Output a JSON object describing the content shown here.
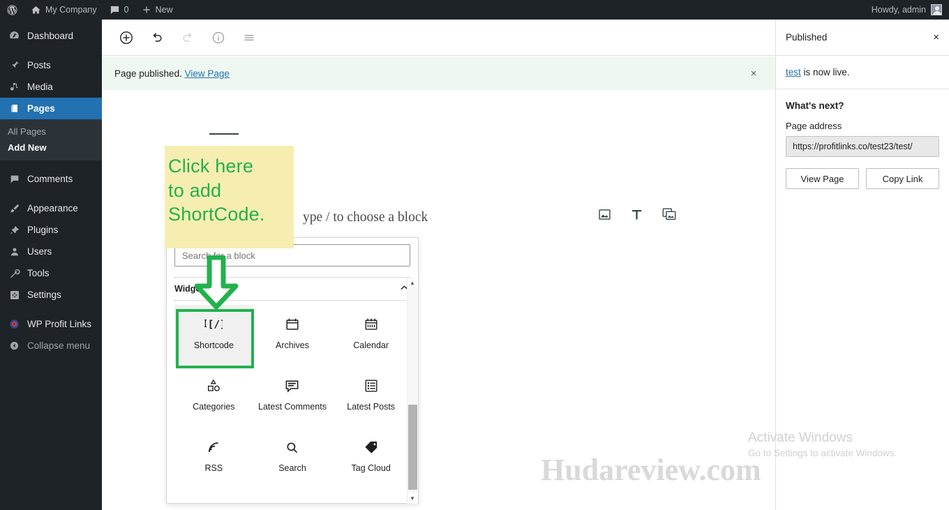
{
  "adminbar": {
    "wp_logo": "wordpress-logo",
    "site_name": "My Company",
    "comments_count": "0",
    "new_label": "New",
    "howdy": "Howdy, admin"
  },
  "sidebar": {
    "items": [
      {
        "label": "Dashboard",
        "icon": "dashboard-icon"
      },
      {
        "label": "Posts",
        "icon": "pin-icon"
      },
      {
        "label": "Media",
        "icon": "media-icon"
      },
      {
        "label": "Pages",
        "icon": "pages-icon"
      },
      {
        "label": "Comments",
        "icon": "comments-icon"
      },
      {
        "label": "Appearance",
        "icon": "brush-icon"
      },
      {
        "label": "Plugins",
        "icon": "plug-icon"
      },
      {
        "label": "Users",
        "icon": "user-icon"
      },
      {
        "label": "Tools",
        "icon": "wrench-icon"
      },
      {
        "label": "Settings",
        "icon": "settings-icon"
      },
      {
        "label": "WP Profit Links",
        "icon": "profit-links-icon"
      },
      {
        "label": "Collapse menu",
        "icon": "collapse-icon"
      }
    ],
    "submenu": [
      {
        "label": "All Pages"
      },
      {
        "label": "Add New"
      }
    ]
  },
  "toolbar": {
    "add_block": "add-block-icon",
    "undo": "undo-icon",
    "redo": "redo-icon",
    "info": "info-icon",
    "list_view": "list-view-icon"
  },
  "notice": {
    "text": "Page published.",
    "link": "View Page",
    "close": "×"
  },
  "canvas": {
    "paragraph_placeholder": "ype / to choose a block",
    "icons": [
      "image-icon",
      "text-icon",
      "gallery-icon"
    ]
  },
  "inserter": {
    "search_placeholder": "Search for a block",
    "category": "Widgets",
    "chevron": "chevron-up-icon",
    "blocks": [
      {
        "label": "Shortcode",
        "icon": "shortcode-icon",
        "selected": true
      },
      {
        "label": "Archives",
        "icon": "archives-icon",
        "selected": false
      },
      {
        "label": "Calendar",
        "icon": "calendar-icon",
        "selected": false
      },
      {
        "label": "Categories",
        "icon": "categories-icon",
        "selected": false
      },
      {
        "label": "Latest Comments",
        "icon": "latest-comments-icon",
        "selected": false
      },
      {
        "label": "Latest Posts",
        "icon": "latest-posts-icon",
        "selected": false
      },
      {
        "label": "RSS",
        "icon": "rss-icon",
        "selected": false
      },
      {
        "label": "Search",
        "icon": "search-icon",
        "selected": false
      },
      {
        "label": "Tag Cloud",
        "icon": "tag-cloud-icon",
        "selected": false
      }
    ]
  },
  "publish_panel": {
    "title": "Published",
    "close": "×",
    "live_link": "test",
    "live_text": " is now live.",
    "whats_next": "What's next?",
    "address_label": "Page address",
    "address_value": "https://profitlinks.co/test23/test/",
    "view_page": "View Page",
    "copy_link": "Copy Link"
  },
  "annotations": {
    "callout_lines": [
      "Click here",
      "to add",
      "ShortCode."
    ],
    "callout_bg": "#f6eeb1",
    "accent_green": "#22b14c"
  },
  "watermarks": {
    "activate_title": "Activate Windows",
    "activate_sub": "Go to Settings to activate Windows.",
    "site": "Hudareview.com"
  }
}
